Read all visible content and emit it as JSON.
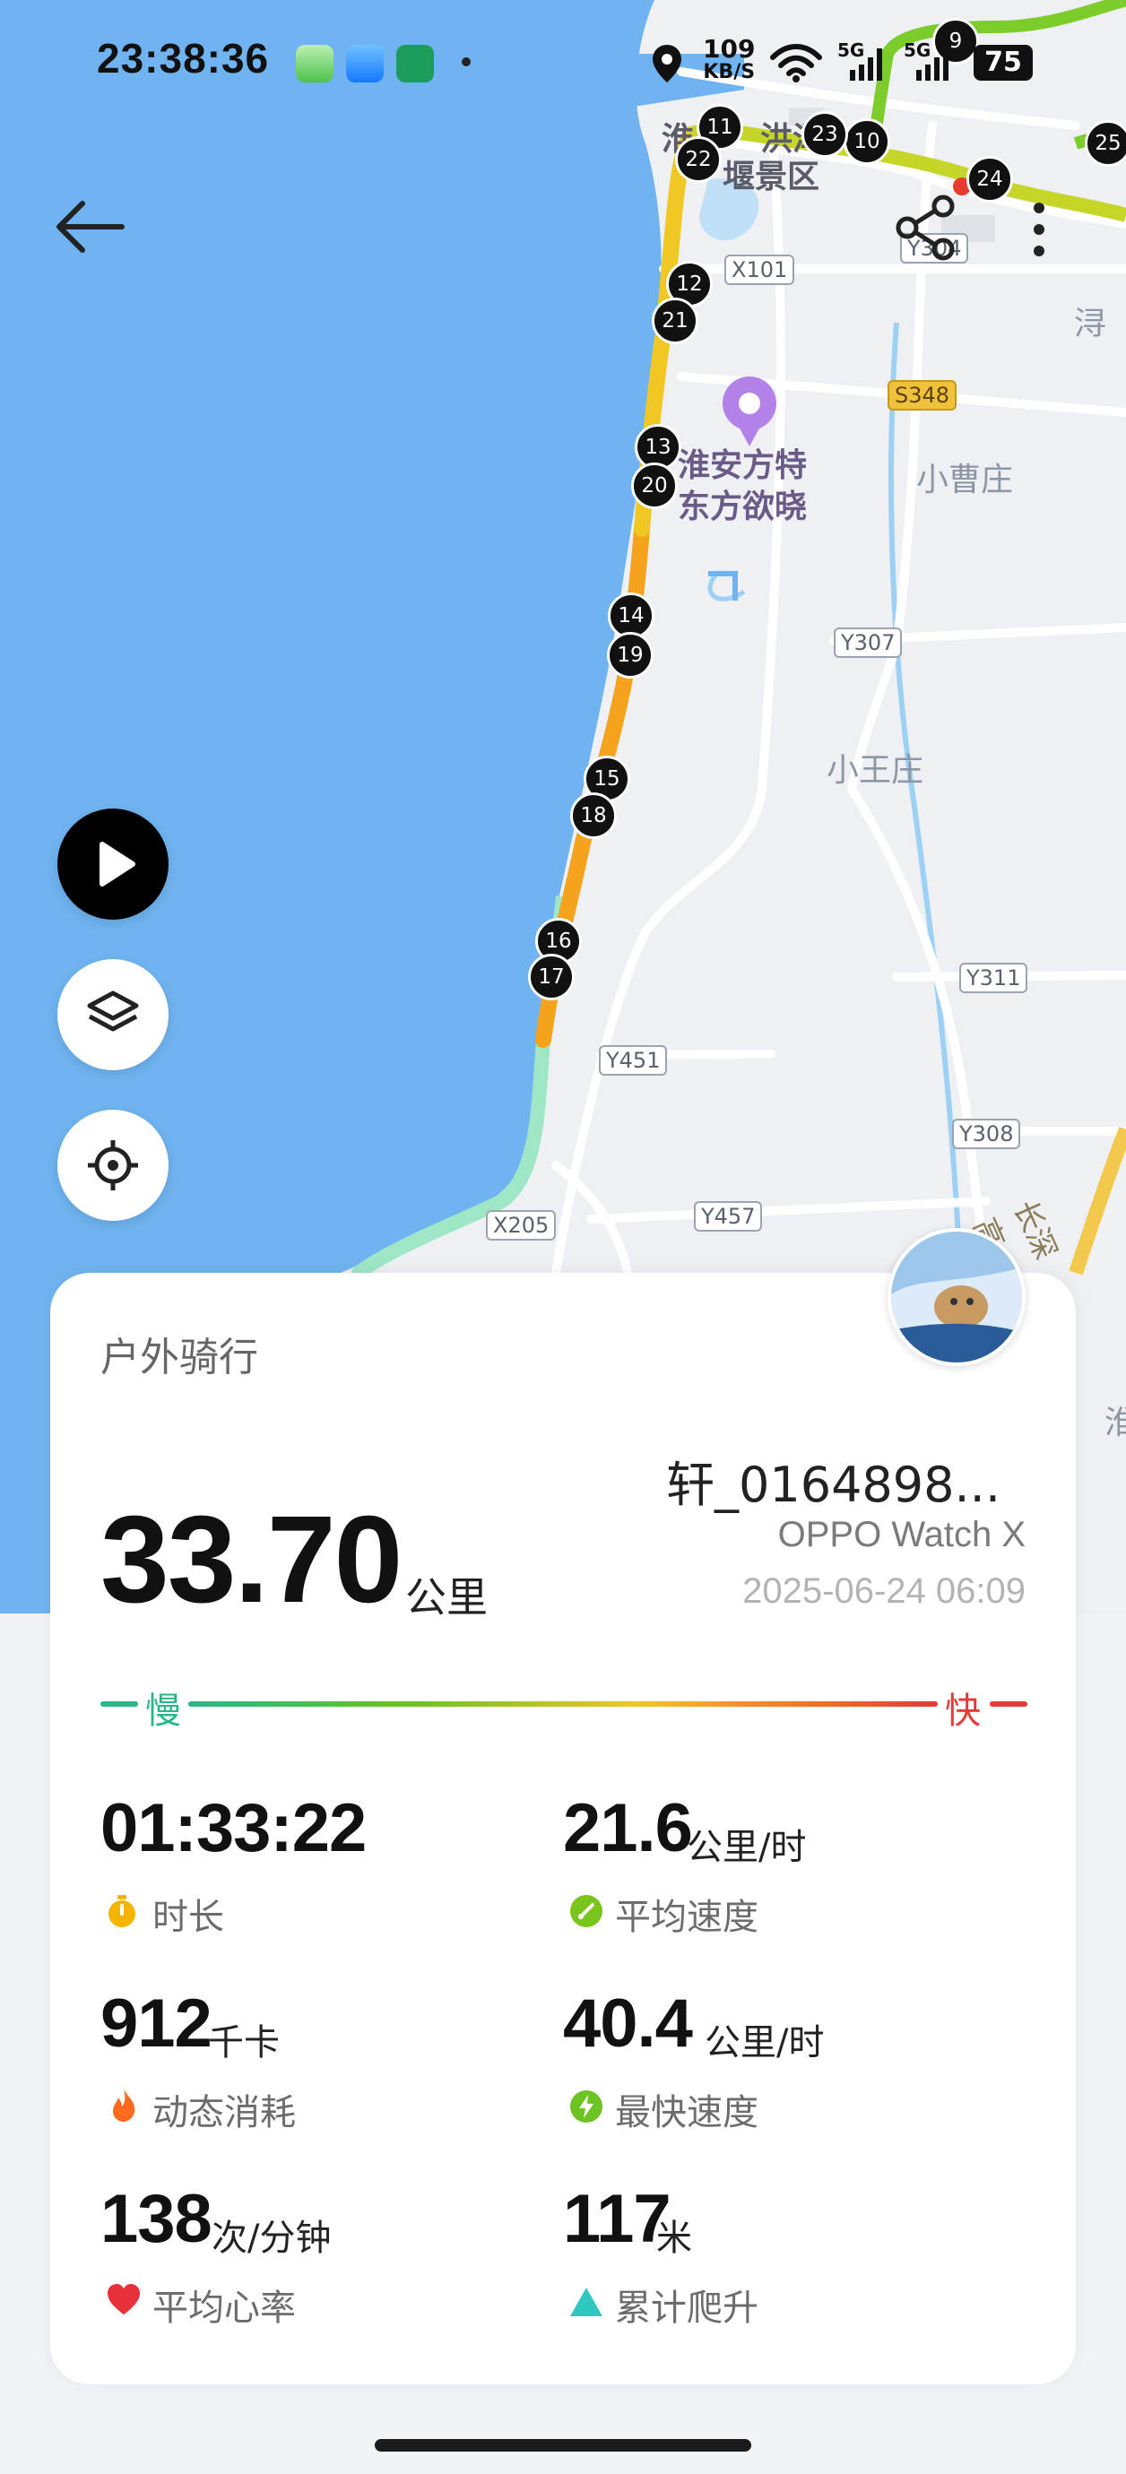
{
  "status_bar": {
    "time": "23:38:36",
    "net_speed_value": "109",
    "net_speed_unit": "KB/S",
    "signal_1": "5G",
    "signal_2": "5G",
    "battery": "75",
    "app_icons": [
      "app-green-icon",
      "app-blue-icon",
      "oppo-app-icon"
    ]
  },
  "map": {
    "place_labels": {
      "scenic_top_a": "淮",
      "scenic_top_b": "洪泽",
      "scenic_top_c": "堰景区",
      "poi_line1": "淮安方特",
      "poi_line2": "东方欲晓",
      "village_1": "小曹庄",
      "village_2": "小王庄",
      "edge_right": "浔",
      "edge_right_2": "淮",
      "road_vertical": "长深高"
    },
    "roads": {
      "x101": "X101",
      "s348": "S348",
      "y307": "Y307",
      "y304": "Y304",
      "y311": "Y311",
      "y451": "Y451",
      "y308": "Y308",
      "y457": "Y457",
      "x205": "X205"
    },
    "markers": [
      "9",
      "10",
      "11",
      "12",
      "13",
      "14",
      "15",
      "16",
      "17",
      "18",
      "19",
      "20",
      "21",
      "22",
      "23",
      "24",
      "25"
    ]
  },
  "header": {
    "back_icon": "back-arrow-icon",
    "share_icon": "share-icon",
    "more_icon": "more-vertical-icon"
  },
  "controls": {
    "play_icon": "play-icon",
    "layers_icon": "layers-icon",
    "locate_icon": "locate-icon"
  },
  "summary": {
    "activity_type": "户外骑行",
    "username": "轩_0164898...",
    "device": "OPPO Watch X",
    "datetime": "2025-06-24 06:09",
    "distance": "33.70",
    "distance_unit": "公里",
    "speed_scale": {
      "slow": "慢",
      "fast": "快"
    }
  },
  "stats": [
    {
      "value": "01:33:22",
      "unit": "",
      "label": "时长",
      "icon": "stopwatch-icon",
      "color": "#f5b400"
    },
    {
      "value": "21.6",
      "unit": "公里/时",
      "label": "平均速度",
      "icon": "speed-gauge-icon",
      "color": "#7ac51c"
    },
    {
      "value": "912",
      "unit": "千卡",
      "label": "动态消耗",
      "icon": "flame-icon",
      "color": "#ff6a1f"
    },
    {
      "value": "40.4",
      "unit": "公里/时",
      "label": "最快速度",
      "icon": "lightning-icon",
      "color": "#6cc322"
    },
    {
      "value": "138",
      "unit": "次/分钟",
      "label": "平均心率",
      "icon": "heart-icon",
      "color": "#e8303a"
    },
    {
      "value": "117",
      "unit": "米",
      "label": "累计爬升",
      "icon": "triangle-up-icon",
      "color": "#2fc7c0"
    }
  ]
}
